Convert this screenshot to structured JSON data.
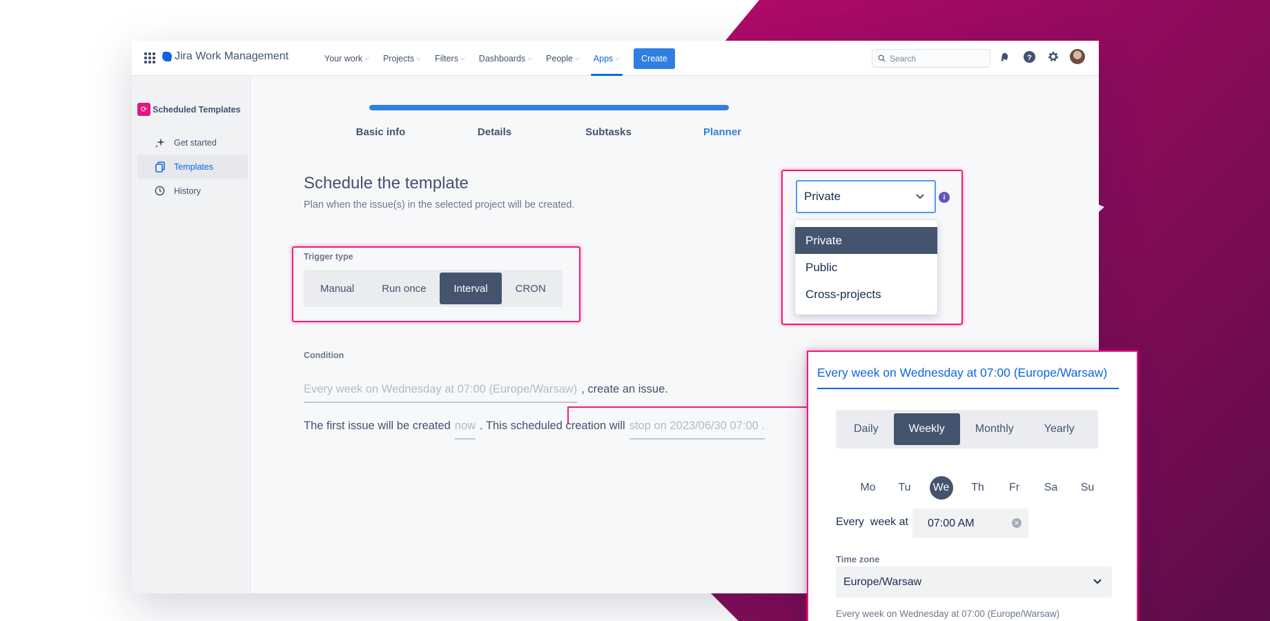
{
  "app": {
    "product_name": "Jira Work Management",
    "nav": [
      {
        "label": "Your work"
      },
      {
        "label": "Projects"
      },
      {
        "label": "Filters"
      },
      {
        "label": "Dashboards"
      },
      {
        "label": "People"
      },
      {
        "label": "Apps"
      }
    ],
    "create_label": "Create",
    "search_placeholder": "Search"
  },
  "sidebar": {
    "title": "Scheduled Templates",
    "items": [
      {
        "label": "Get started",
        "icon": "sparkle-icon"
      },
      {
        "label": "Templates",
        "icon": "copy-icon"
      },
      {
        "label": "History",
        "icon": "clock-icon"
      }
    ]
  },
  "steps": [
    "Basic info",
    "Details",
    "Subtasks",
    "Planner"
  ],
  "main": {
    "title": "Schedule the template",
    "subtitle": "Plan when the issue(s) in the selected project will be created.",
    "trigger": {
      "label": "Trigger type",
      "options": [
        "Manual",
        "Run once",
        "Interval",
        "CRON"
      ],
      "selected": "Interval"
    },
    "condition": {
      "label": "Condition",
      "schedule_text": "Every week on Wednesday at 07:00 (Europe/Warsaw)",
      "after_schedule": ", create an issue.",
      "first_prefix": "The first issue will be created",
      "first_value": "now",
      "middle": ". This scheduled creation will",
      "stop_value": "stop on 2023/06/30 07:00 ."
    }
  },
  "visibility": {
    "selected": "Private",
    "options": [
      "Private",
      "Public",
      "Cross-projects"
    ]
  },
  "panel": {
    "title": "Every week on Wednesday at 07:00 (Europe/Warsaw)",
    "frequencies": [
      "Daily",
      "Weekly",
      "Monthly",
      "Yearly"
    ],
    "selected_frequency": "Weekly",
    "days": [
      "Mo",
      "Tu",
      "We",
      "Th",
      "Fr",
      "Sa",
      "Su"
    ],
    "selected_day": "We",
    "every_label": "Every  week at",
    "time_value": "07:00 AM",
    "timezone_label": "Time zone",
    "timezone_value": "Europe/Warsaw",
    "footer": "Every week on Wednesday at 07:00 (Europe/Warsaw)"
  },
  "colors": {
    "accent": "#2f7fe0",
    "highlight": "#f0197f",
    "selected_dark": "#44546f"
  }
}
